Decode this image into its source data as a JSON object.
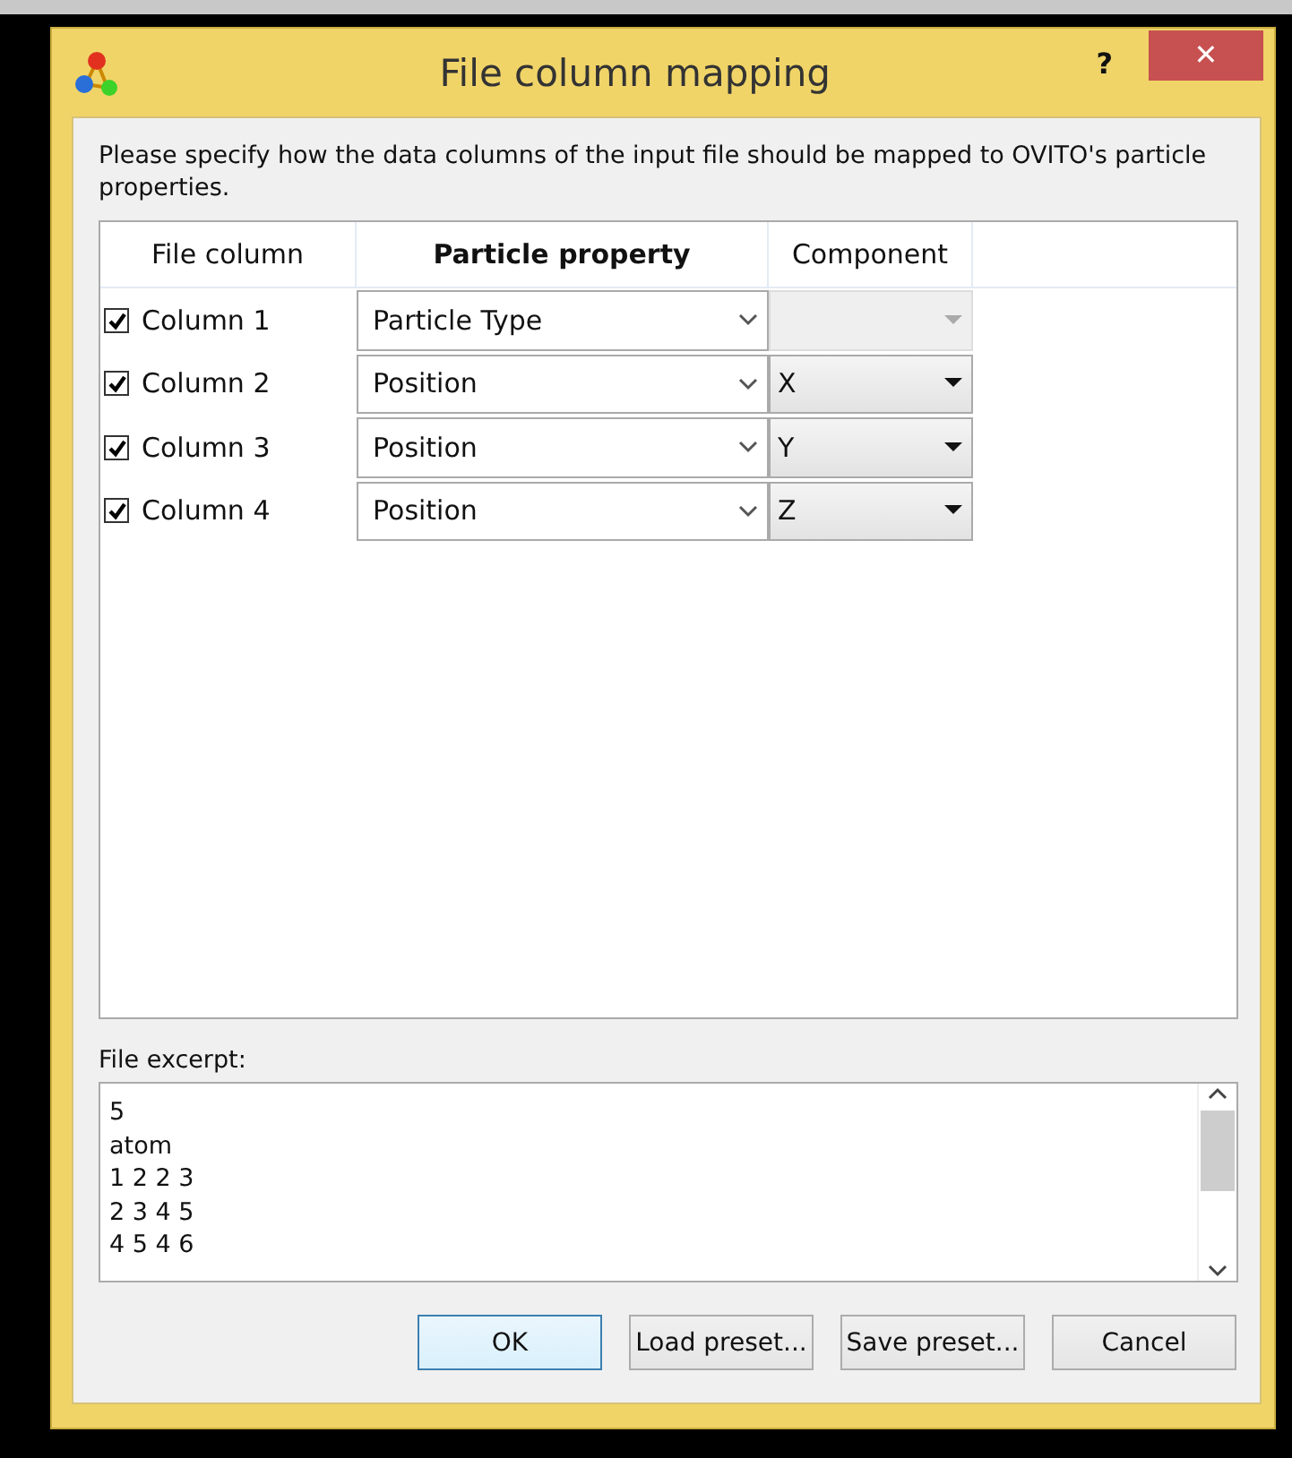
{
  "window": {
    "title": "File column mapping",
    "help_button": "?",
    "close_button": "✕"
  },
  "instructions": "Please specify how the data columns of the input file should be mapped to OVITO's particle properties.",
  "table": {
    "columns": [
      {
        "label": "File column",
        "selected": false
      },
      {
        "label": "Particle property",
        "selected": true
      },
      {
        "label": "Component",
        "selected": false
      }
    ],
    "rows": [
      {
        "checked": true,
        "column": "Column 1",
        "property": "Particle Type",
        "component_enabled": false
      },
      {
        "checked": true,
        "column": "Column 2",
        "property": "Position",
        "component": "X",
        "component_enabled": true
      },
      {
        "checked": true,
        "column": "Column 3",
        "property": "Position",
        "component": "Y",
        "component_enabled": true
      },
      {
        "checked": true,
        "column": "Column 4",
        "property": "Position",
        "component": "Z",
        "component_enabled": true
      }
    ]
  },
  "excerpt": {
    "label": "File excerpt:",
    "lines": [
      "5",
      "atom",
      "1 2 2 3",
      "2 3 4 5",
      "4 5 4 6"
    ]
  },
  "buttons": [
    {
      "label": "OK",
      "default": true
    },
    {
      "label": "Load preset...",
      "default": false
    },
    {
      "label": "Save preset...",
      "default": false
    },
    {
      "label": "Cancel",
      "default": false
    }
  ]
}
